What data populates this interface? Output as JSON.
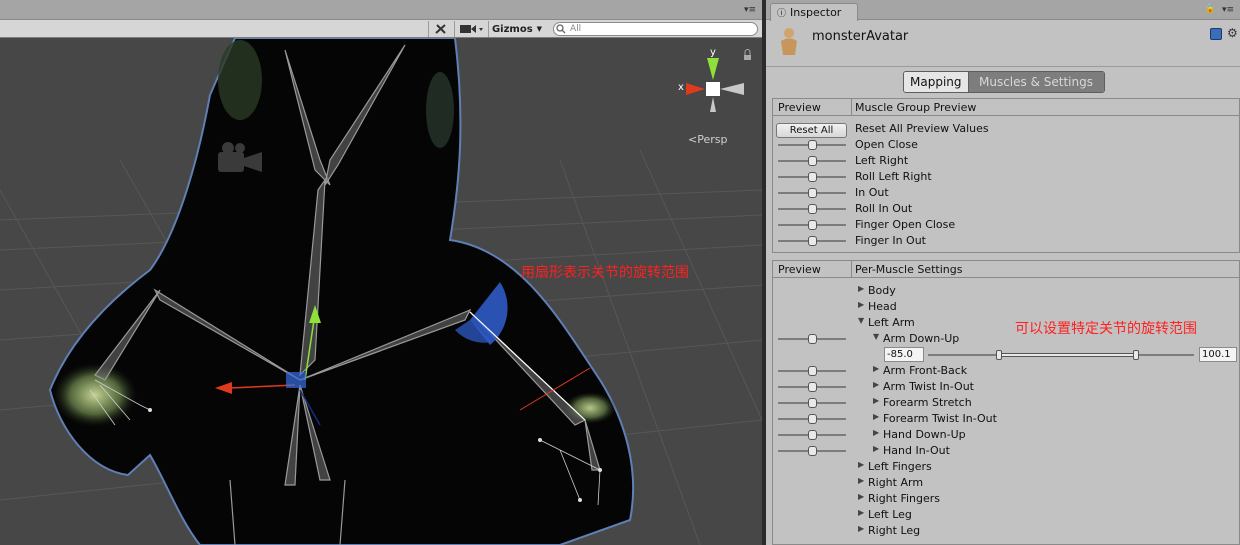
{
  "scene": {
    "toolbar": {
      "gizmos_label": "Gizmos",
      "search_placeholder": "All"
    },
    "persp_label": "Persp",
    "axis_labels": {
      "x": "x",
      "y": "y"
    },
    "annotation": "用扇形表示关节的旋转范围"
  },
  "inspector": {
    "tab_label": "Inspector",
    "asset_name": "monsterAvatar",
    "mode_tabs": [
      "Mapping",
      "Muscles & Settings"
    ],
    "muscle_group_preview": {
      "col_preview": "Preview",
      "col_title": "Muscle Group Preview",
      "reset_button": "Reset All",
      "reset_label": "Reset All Preview Values",
      "items": [
        "Open Close",
        "Left Right",
        "Roll Left Right",
        "In Out",
        "Roll In Out",
        "Finger Open Close",
        "Finger In Out"
      ]
    },
    "per_muscle": {
      "col_preview": "Preview",
      "col_title": "Per-Muscle Settings",
      "annotation": "可以设置特定关节的旋转范围",
      "items": [
        {
          "label": "Body",
          "expanded": false
        },
        {
          "label": "Head",
          "expanded": false
        },
        {
          "label": "Left Arm",
          "expanded": true
        },
        {
          "label": "Arm Down-Up",
          "expanded": true
        },
        {
          "label": "Arm Front-Back",
          "expanded": false
        },
        {
          "label": "Arm Twist In-Out",
          "expanded": false
        },
        {
          "label": "Forearm Stretch",
          "expanded": false
        },
        {
          "label": "Forearm Twist In-Out",
          "expanded": false
        },
        {
          "label": "Hand Down-Up",
          "expanded": false
        },
        {
          "label": "Hand In-Out",
          "expanded": false
        },
        {
          "label": "Left Fingers",
          "expanded": false
        },
        {
          "label": "Right Arm",
          "expanded": false
        },
        {
          "label": "Right Fingers",
          "expanded": false
        },
        {
          "label": "Left Leg",
          "expanded": false
        },
        {
          "label": "Right Leg",
          "expanded": false
        }
      ],
      "range_min": "-85.0",
      "range_max": "100.1"
    }
  },
  "colors": {
    "x_axis": "#e03a1e",
    "y_axis": "#8ee03a",
    "z_axis": "#3a6ee0",
    "annotation": "#ff2020",
    "range_arc": "#2f5bc7"
  }
}
